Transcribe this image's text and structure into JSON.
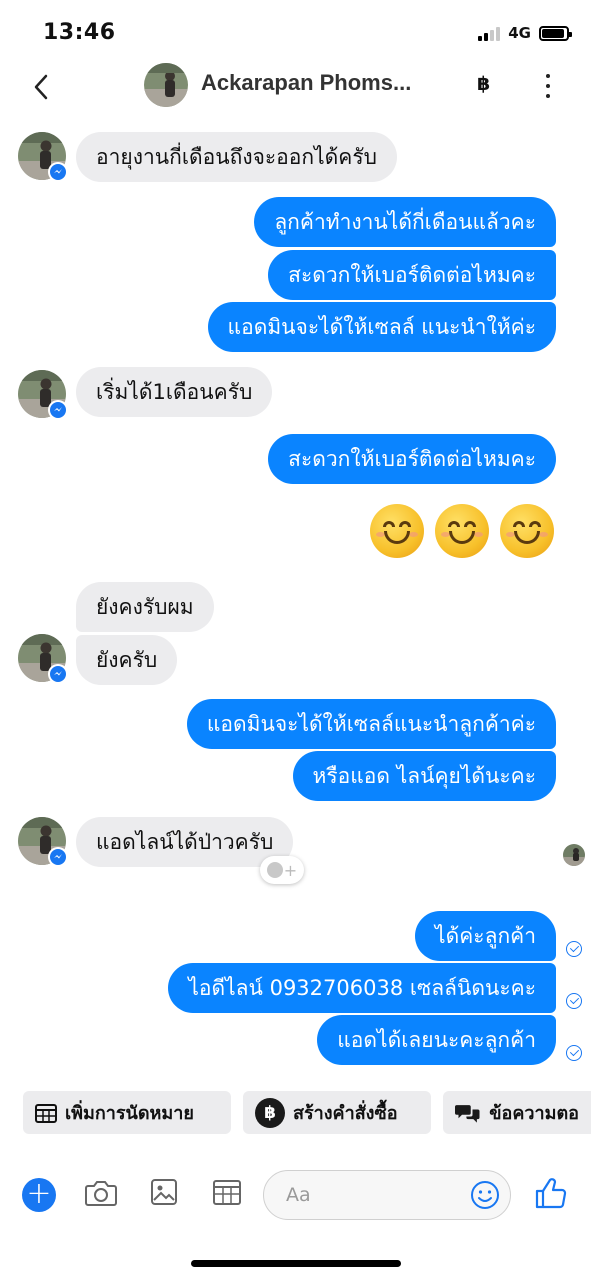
{
  "status_bar": {
    "time": "13:46",
    "network": "4G"
  },
  "header": {
    "contact_name": "Ackarapan Phoms...",
    "currency_icon": "฿"
  },
  "messages": [
    {
      "id": 0,
      "side": "in",
      "text": "อายุงานกี่เดือนถึงจะออกได้ครับ"
    },
    {
      "id": 1,
      "side": "out",
      "text": "ลูกค้าทำงานได้กี่เดือนแล้วคะ"
    },
    {
      "id": 2,
      "side": "out",
      "text": "สะดวกให้เบอร์ติดต่อไหมคะ"
    },
    {
      "id": 3,
      "side": "out",
      "text": "แอดมินจะได้ให้เซลล์ แนะนำให้ค่ะ"
    },
    {
      "id": 4,
      "side": "in",
      "text": "เริ่มได้1เดือนครับ"
    },
    {
      "id": 5,
      "side": "out",
      "text": "สะดวกให้เบอร์ติดต่อไหมคะ"
    },
    {
      "id": 6,
      "side": "out",
      "text": "😊😊😊"
    },
    {
      "id": 7,
      "side": "in",
      "text": "ยังคงรับผม"
    },
    {
      "id": 8,
      "side": "in",
      "text": "ยังครับ"
    },
    {
      "id": 9,
      "side": "out",
      "text": "แอดมินจะได้ให้เซลล์แนะนำลูกค้าค่ะ"
    },
    {
      "id": 10,
      "side": "out",
      "text": "หรือแอด ไลน์คุยได้นะคะ"
    },
    {
      "id": 11,
      "side": "in",
      "text": "แอดไลน์ได้ป่าวครับ"
    },
    {
      "id": 12,
      "side": "out",
      "text": "ได้ค่ะลูกค้า"
    },
    {
      "id": 13,
      "side": "out",
      "text": "ไอดีไลน์ 0932706038 เซลล์นิดนะคะ"
    },
    {
      "id": 14,
      "side": "out",
      "text": "แอดได้เลยนะคะลูกค้า"
    }
  ],
  "quick_actions": [
    {
      "label": "เพิ่มการนัดหมาย",
      "icon": "calendar-icon"
    },
    {
      "label": "สร้างคำสั่งซื้อ",
      "icon": "baht-icon"
    },
    {
      "label": "ข้อความตอ",
      "icon": "chat-bubbles-icon"
    }
  ],
  "composer": {
    "placeholder": "Aa"
  },
  "colors": {
    "accent": "#1877f2",
    "outgoing_bubble": "#0a84ff",
    "incoming_bubble": "#ececee"
  }
}
